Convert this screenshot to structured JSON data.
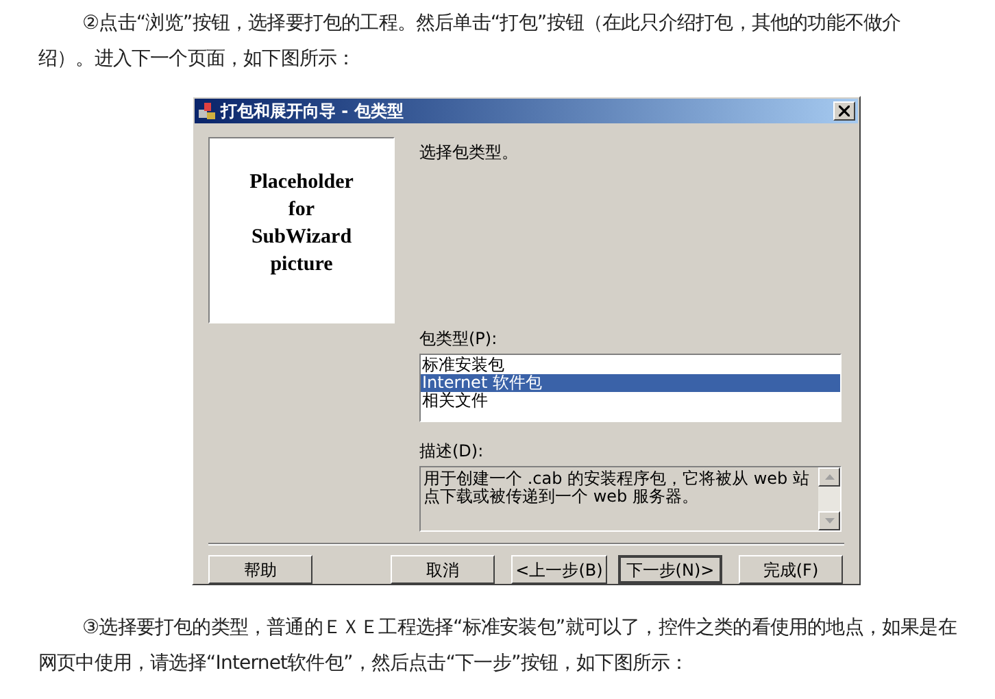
{
  "paragraph_1": {
    "lines": [
      "②点击“浏览”按钮，选择要打包的工程。然后单击“打包”按钮（在此只介绍打包，其他的功能不做介",
      "绍）。进入下一个页面，如下图所示："
    ]
  },
  "dialog": {
    "title": "打包和展开向导 - 包类型",
    "picture_text": [
      "Placeholder",
      "for",
      "SubWizard",
      "picture"
    ],
    "prompt": "选择包类型。",
    "list_label": "包类型(P):",
    "list_items": [
      {
        "label": "标准安装包",
        "selected": false
      },
      {
        "label": "Internet 软件包",
        "selected": true
      },
      {
        "label": "相关文件",
        "selected": false
      }
    ],
    "description_label": "描述(D):",
    "description": "用于创建一个 .cab 的安装程序包，它将被从 web 站点下载或被传递到一个 web 服务器。",
    "buttons": [
      {
        "label": "帮助",
        "default": false
      },
      {
        "label": "取消",
        "default": false
      },
      {
        "label": "<上一步(B)",
        "default": false
      },
      {
        "label": "下一步(N)>",
        "default": true
      },
      {
        "label": "完成(F)",
        "default": false
      }
    ]
  },
  "paragraph_2": {
    "lines": [
      "③选择要打包的类型，普通的ＥＸＥ工程选择“标准安装包”就可以了，控件之类的看使用的地点，如果是在",
      "网页中使用，请选择“Internet软件包”，然后点击“下一步”按钮，如下图所示："
    ]
  }
}
